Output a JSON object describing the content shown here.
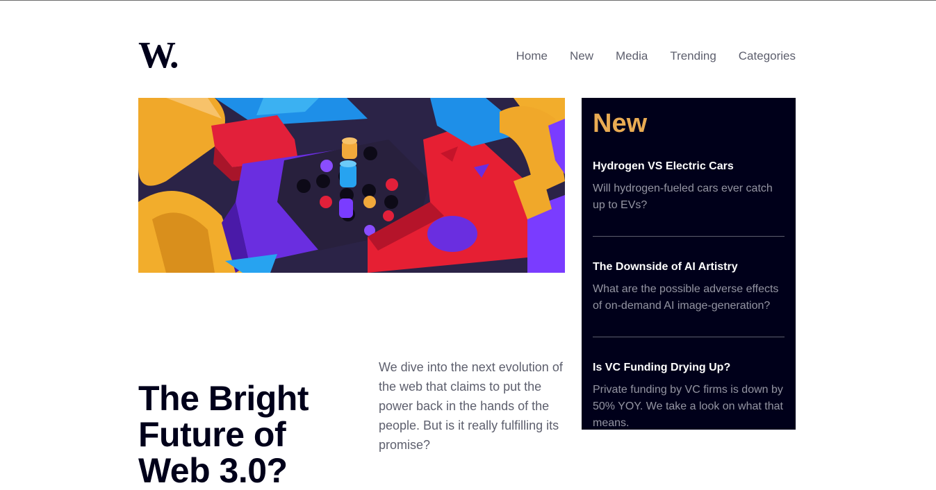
{
  "header": {
    "logo_text": "W.",
    "nav": [
      "Home",
      "New",
      "Media",
      "Trending",
      "Categories"
    ]
  },
  "hero": {
    "icon": "abstract-3d-blocks-image"
  },
  "article": {
    "headline": "The Bright Future of Web 3.0?",
    "intro": "We dive into the next evolution of the web that claims to put the power back in the hands of the people. But is it really fulfilling its promise?"
  },
  "sidebar": {
    "title": "New",
    "items": [
      {
        "title": "Hydrogen VS Electric Cars",
        "desc": "Will hydrogen-fueled cars ever catch up to EVs?"
      },
      {
        "title": "The Downside of AI Artistry",
        "desc": "What are the possible adverse effects of on-demand AI image-generation?"
      },
      {
        "title": "Is VC Funding Drying Up?",
        "desc": "Private funding by VC firms is down by 50% YOY. We take a look on what that means."
      }
    ]
  },
  "colors": {
    "dark_navy": "#00001a",
    "accent_orange": "#e9ab53",
    "grey_text": "#5d5f6d"
  }
}
